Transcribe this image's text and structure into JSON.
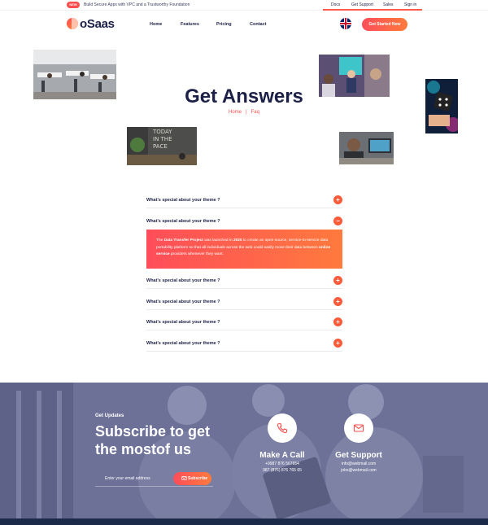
{
  "topbar": {
    "badge": "NEW",
    "announcement": "Build Secure Apps with VPC and a Trustworthy Foundation",
    "links": [
      "Docs",
      "Get Support",
      "Sales",
      "Sign in"
    ]
  },
  "header": {
    "logo_text": "oSaas",
    "nav": [
      "Home",
      "Features",
      "Pricing",
      "Contact"
    ],
    "cta_label": "Get Started Now"
  },
  "hero": {
    "title": "Get Answers",
    "breadcrumb": [
      "Home",
      "Faq"
    ],
    "breadcrumb_separator": "|"
  },
  "faq": {
    "items": [
      {
        "question": "What's special about your theme ?",
        "toggle": "+"
      },
      {
        "question": "What's special about your theme ?",
        "toggle": "−"
      },
      {
        "question": "What's special about your theme ?",
        "toggle": "+"
      },
      {
        "question": "What's special about your theme ?",
        "toggle": "+"
      },
      {
        "question": "What's special about your theme ?",
        "toggle": "+"
      },
      {
        "question": "What's special about your theme ?",
        "toggle": "+"
      }
    ],
    "answer": {
      "t1": "The ",
      "b1": "Data Transfer Project",
      "t2": " was launched in ",
      "b2": "2020",
      "t3": " to create an open-source, service-to-service data portability platform so that all individuals across the web could easily move their data between ",
      "b3": "online service",
      "t4": " providers whenever they want."
    }
  },
  "subscribe": {
    "eyebrow": "Get Updates",
    "title": "Subscribe to get the mostof us",
    "email_placeholder": "Enter your email address",
    "button_label": "Subscribe"
  },
  "contacts": [
    {
      "title": "Make A Call",
      "lines": [
        "+9987 876 567654",
        "987 (876) 876 765 65"
      ],
      "icon": "phone-icon"
    },
    {
      "title": "Get Support",
      "lines": [
        "info@webmail.com",
        "jobs@webmail.com"
      ],
      "icon": "mail-icon"
    }
  ],
  "colors": {
    "accent": "#ff5b3a",
    "navy": "#1c2047",
    "subscribe_bg": "#6d7197"
  }
}
